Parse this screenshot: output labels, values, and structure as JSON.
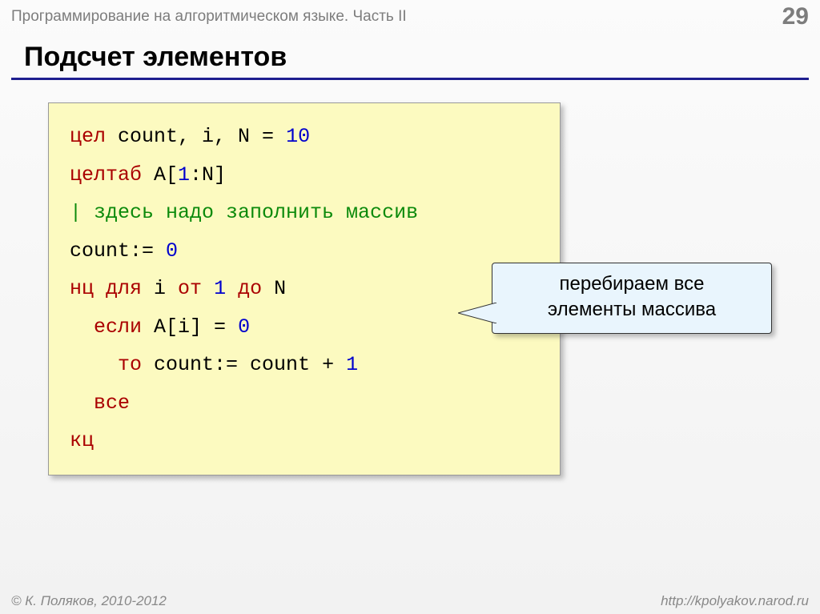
{
  "header": {
    "breadcrumb": "Программирование на алгоритмическом языке. Часть II",
    "page_number": "29"
  },
  "title": "Подсчет элементов",
  "code": {
    "l1_kw": "цел",
    "l1_rest": " count, i, N = ",
    "l1_num": "10",
    "l2_kw": "целтаб",
    "l2_rest": " A[",
    "l2_num": "1",
    "l2_rest2": ":N]",
    "l3_cmt": "| здесь надо заполнить массив",
    "l4": "count:= ",
    "l4_num": "0",
    "l5_kw1": "нц для",
    "l5_mid": " i ",
    "l5_kw2": "от",
    "l5_sp1": " ",
    "l5_num": "1",
    "l5_sp2": " ",
    "l5_kw3": "до",
    "l5_end": " N",
    "l6_indent": "  ",
    "l6_kw": "если",
    "l6_rest": " A[i] = ",
    "l6_num": "0",
    "l7_indent": "    ",
    "l7_kw": "то",
    "l7_rest": " count:= count + ",
    "l7_num": "1",
    "l8_indent": "  ",
    "l8_kw": "все",
    "l9_kw": "кц"
  },
  "callout": {
    "line1": "перебираем все",
    "line2": "элементы массива"
  },
  "footer": {
    "left": "© К. Поляков, 2010-2012",
    "right": "http://kpolyakov.narod.ru"
  }
}
